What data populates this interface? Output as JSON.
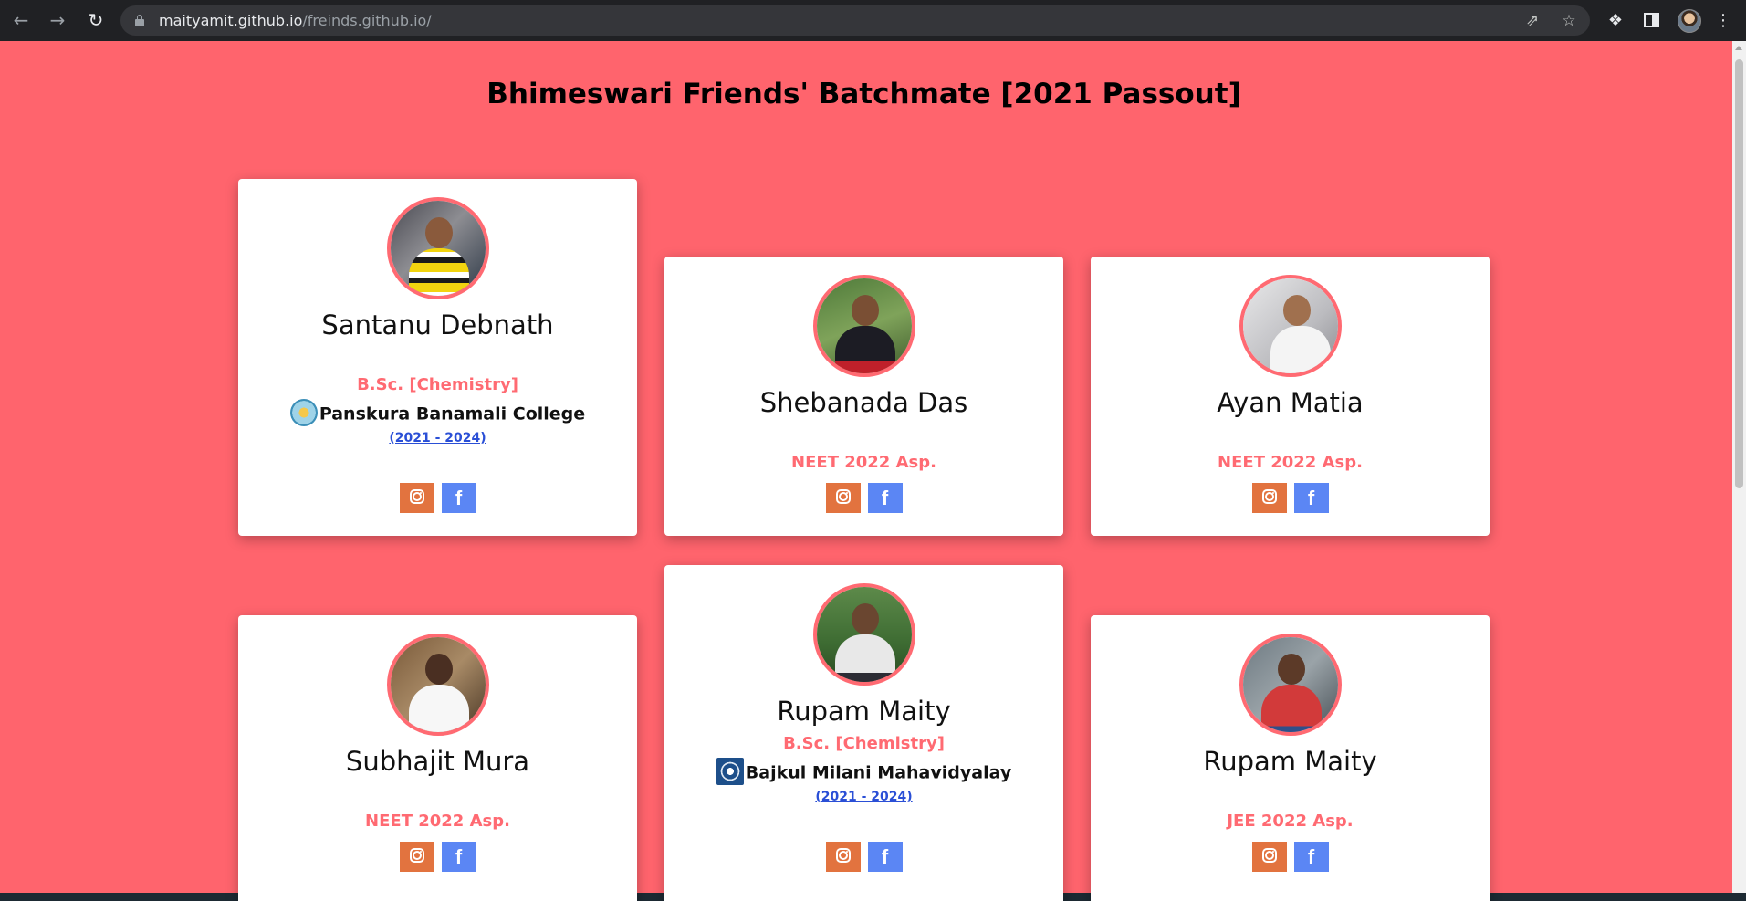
{
  "browser": {
    "url_host": "maityamit.github.io",
    "url_path": "/freinds.github.io/"
  },
  "page": {
    "title": "Bhimeswari Friends' Batchmate [2021 Passout]"
  },
  "cards": [
    {
      "name": "Santanu Debnath",
      "course": "B.Sc. [Chemistry]",
      "college": "Panskura Banamali College",
      "years": "(2021 - 2024)",
      "instagram_icon": "instagram-icon",
      "facebook_label": "f"
    },
    {
      "name": "Shebanada Das",
      "course": "NEET 2022 Asp.",
      "instagram_icon": "instagram-icon",
      "facebook_label": "f"
    },
    {
      "name": "Ayan Matia",
      "course": "NEET 2022 Asp.",
      "instagram_icon": "instagram-icon",
      "facebook_label": "f"
    },
    {
      "name": "Subhajit Mura",
      "course": "NEET 2022 Asp.",
      "instagram_icon": "instagram-icon",
      "facebook_label": "f"
    },
    {
      "name": "Rupam Maity",
      "course": "B.Sc. [Chemistry]",
      "college": "Bajkul Milani Mahavidyalay",
      "years": "(2021 - 2024)",
      "instagram_icon": "instagram-icon",
      "facebook_label": "f"
    },
    {
      "name": "Rupam Maity",
      "course": "JEE 2022 Asp.",
      "instagram_icon": "instagram-icon",
      "facebook_label": "f"
    }
  ],
  "colors": {
    "page_background": "#ff646d",
    "accent": "#ff6a72",
    "instagram_button": "#e2733f",
    "facebook_button": "#5b86f4",
    "link": "#2a4fd6"
  }
}
